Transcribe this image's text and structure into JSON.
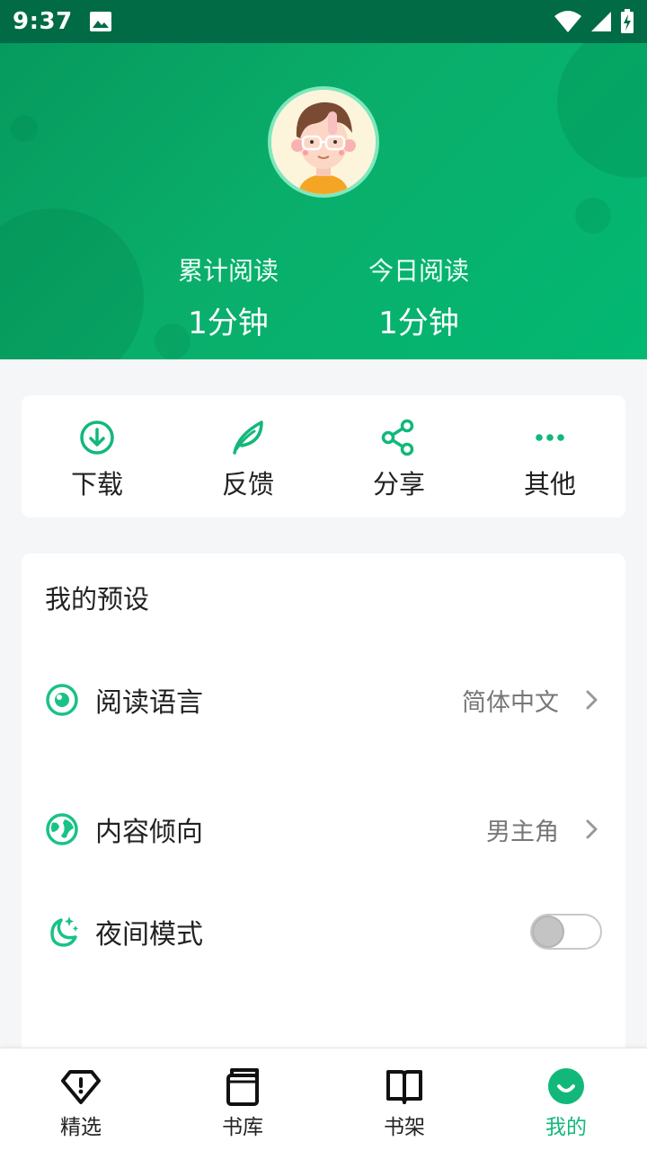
{
  "status_bar": {
    "time": "9:37"
  },
  "header": {
    "stats": [
      {
        "label": "累计阅读",
        "value": "1分钟"
      },
      {
        "label": "今日阅读",
        "value": "1分钟"
      }
    ]
  },
  "actions": [
    {
      "label": "下载",
      "icon": "download-icon"
    },
    {
      "label": "反馈",
      "icon": "feather-icon"
    },
    {
      "label": "分享",
      "icon": "share-icon"
    },
    {
      "label": "其他",
      "icon": "more-icon"
    }
  ],
  "preferences": {
    "title": "我的预设",
    "reading_language": {
      "label": "阅读语言",
      "value": "简体中文",
      "icon": "eye-icon"
    },
    "content_preference": {
      "label": "内容倾向",
      "value": "男主角",
      "icon": "globe-icon"
    },
    "night_mode": {
      "label": "夜间模式",
      "enabled": false,
      "icon": "moon-icon"
    }
  },
  "bottom_nav": [
    {
      "label": "精选",
      "icon": "diamond-icon",
      "active": false
    },
    {
      "label": "书库",
      "icon": "book-stack-icon",
      "active": false
    },
    {
      "label": "书架",
      "icon": "open-book-icon",
      "active": false
    },
    {
      "label": "我的",
      "icon": "smile-icon",
      "active": true
    }
  ],
  "colors": {
    "accent": "#12b87a",
    "header_bg": "#0aae6b",
    "status_bar_bg": "#006b44"
  }
}
